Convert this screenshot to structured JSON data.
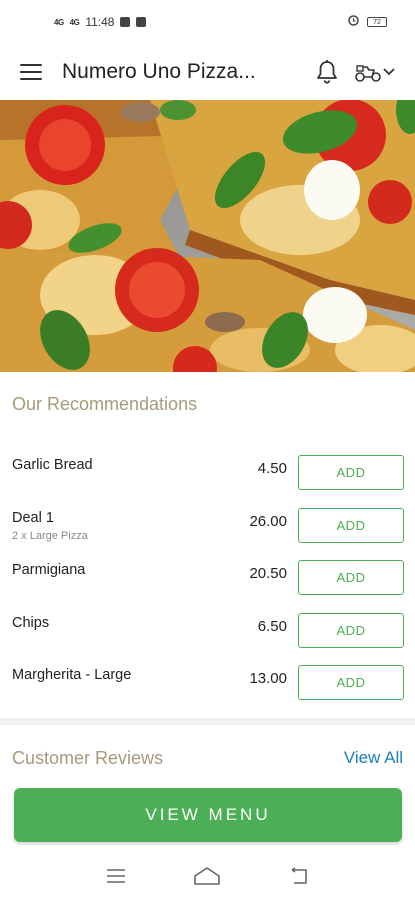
{
  "status_bar": {
    "signal_1": "4G",
    "signal_2": "4G",
    "time": "11:48",
    "battery_level": "72"
  },
  "header": {
    "title": "Numero Uno Pizza..."
  },
  "recommendations": {
    "title": "Our Recommendations",
    "add_label": "ADD",
    "items": [
      {
        "name": "Garlic Bread",
        "subtitle": "",
        "price": "4.50"
      },
      {
        "name": "Deal 1",
        "subtitle": "2 x Large Pizza",
        "price": "26.00"
      },
      {
        "name": "Parmigiana",
        "subtitle": "",
        "price": "20.50"
      },
      {
        "name": "Chips",
        "subtitle": "",
        "price": "6.50"
      },
      {
        "name": "Margherita - Large",
        "subtitle": "",
        "price": "13.00"
      }
    ]
  },
  "reviews": {
    "title": "Customer Reviews",
    "view_all_label": "View All"
  },
  "footer": {
    "view_menu_label": "VIEW MENU"
  },
  "colors": {
    "accent_green": "#4caf55",
    "section_title": "#a79a7c",
    "link_blue": "#1a7fb8"
  },
  "icons": {
    "menu": "hamburger-icon",
    "notifications": "bell-icon",
    "delivery": "scooter-icon",
    "dropdown": "chevron-down-icon"
  }
}
